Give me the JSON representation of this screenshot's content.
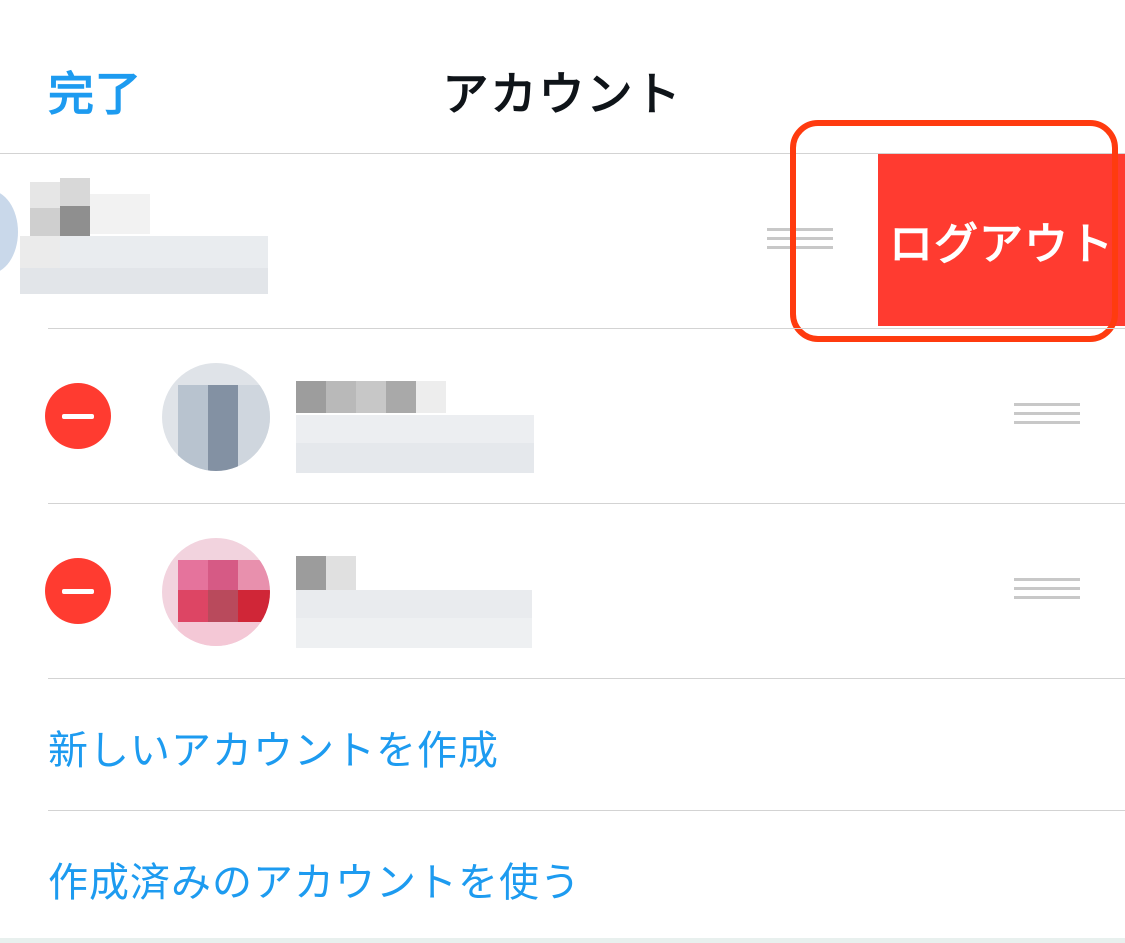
{
  "navbar": {
    "done_label": "完了",
    "title": "アカウント"
  },
  "accounts": [
    {
      "swiped": true,
      "action_label": "ログアウト"
    },
    {
      "swiped": false
    },
    {
      "swiped": false
    }
  ],
  "links": {
    "create_new": "新しいアカウントを作成",
    "use_existing": "作成済みのアカウントを使う"
  },
  "colors": {
    "accent": "#1d9bf0",
    "destructive": "#ff3b30",
    "highlight": "#ff3b0f",
    "separator": "#d3d3d3"
  }
}
